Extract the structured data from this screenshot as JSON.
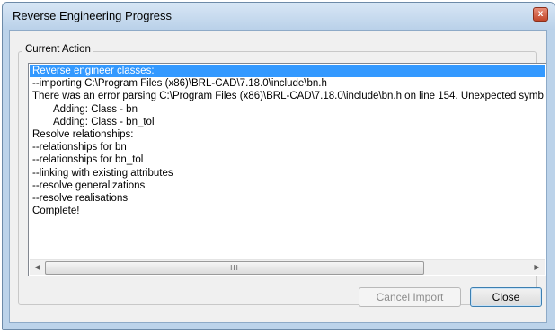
{
  "window": {
    "title": "Reverse Engineering Progress",
    "close_glyph": "x",
    "close_icon": "close-icon"
  },
  "group": {
    "label": "Current Action"
  },
  "log": {
    "lines": [
      "Reverse engineer classes:",
      "--importing C:\\Program Files (x86)\\BRL-CAD\\7.18.0\\include\\bn.h",
      "There was an error parsing C:\\Program Files (x86)\\BRL-CAD\\7.18.0\\include\\bn.h on line 154.  Unexpected symb",
      "Adding: Class - bn",
      "Adding: Class - bn_tol",
      "Resolve relationships:",
      "--relationships for bn",
      "--relationships for bn_tol",
      "--linking with existing attributes",
      "--resolve generalizations",
      "--resolve realisations",
      "Complete!"
    ],
    "selected_line": "Reverse engineer classes:"
  },
  "scrollbar": {
    "left_arrow": "◀",
    "right_arrow": "▶",
    "grip": "III"
  },
  "buttons": {
    "cancel_label": "Cancel Import",
    "close_mnemonic": "C",
    "close_rest": "lose"
  },
  "colors": {
    "selection": "#3399ff",
    "window_frame": "#bcd3ea",
    "client_bg": "#f0f0f0",
    "close_red": "#c2472b"
  }
}
